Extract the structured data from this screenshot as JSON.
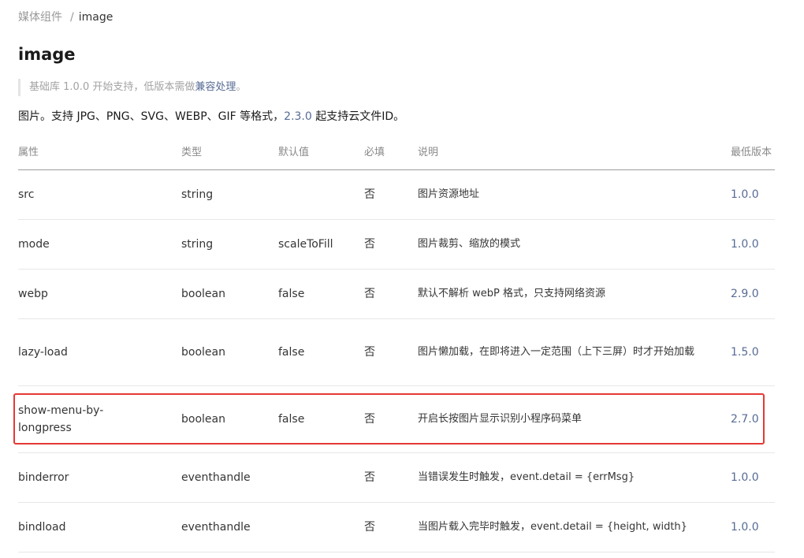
{
  "breadcrumb": {
    "parent": "媒体组件",
    "separator": "/",
    "current": "image"
  },
  "title": "image",
  "tip": {
    "prefix": "基础库 1.0.0 开始支持，低版本需做",
    "link": "兼容处理",
    "suffix": "。"
  },
  "intro": {
    "prefix": "图片。支持 JPG、PNG、SVG、WEBP、GIF 等格式，",
    "link": "2.3.0",
    "suffix": " 起支持云文件ID。"
  },
  "table": {
    "headers": {
      "name": "属性",
      "type": "类型",
      "default": "默认值",
      "required": "必填",
      "desc": "说明",
      "version": "最低版本"
    },
    "rows": [
      {
        "name": "src",
        "type": "string",
        "default": "",
        "required": "否",
        "desc": "图片资源地址",
        "version": "1.0.0"
      },
      {
        "name": "mode",
        "type": "string",
        "default": "scaleToFill",
        "required": "否",
        "desc": "图片裁剪、缩放的模式",
        "version": "1.0.0"
      },
      {
        "name": "webp",
        "type": "boolean",
        "default": "false",
        "required": "否",
        "desc": "默认不解析 webP 格式，只支持网络资源",
        "version": "2.9.0"
      },
      {
        "name": "lazy-load",
        "type": "boolean",
        "default": "false",
        "required": "否",
        "desc": "图片懒加载，在即将进入一定范围（上下三屏）时才开始加载",
        "version": "1.5.0"
      },
      {
        "name": "show-menu-by-longpress",
        "type": "boolean",
        "default": "false",
        "required": "否",
        "desc": "开启长按图片显示识别小程序码菜单",
        "version": "2.7.0"
      },
      {
        "name": "binderror",
        "type": "eventhandle",
        "default": "",
        "required": "否",
        "desc": "当错误发生时触发，event.detail = {errMsg}",
        "version": "1.0.0"
      },
      {
        "name": "bindload",
        "type": "eventhandle",
        "default": "",
        "required": "否",
        "desc": "当图片载入完毕时触发，event.detail = {height, width}",
        "version": "1.0.0"
      }
    ]
  },
  "highlight": {
    "color": "#e53935",
    "row_name": "show-menu-by-longpress"
  },
  "colors": {
    "link": "#576b95",
    "text": "#353535",
    "muted": "#9a9a9a"
  }
}
